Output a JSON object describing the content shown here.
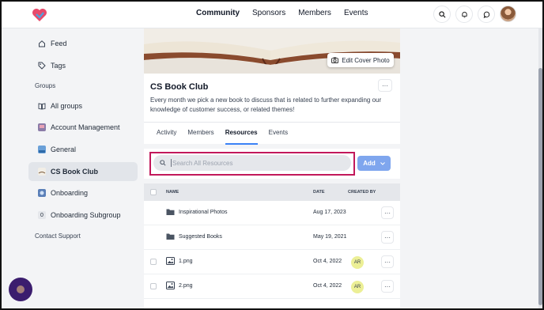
{
  "nav": {
    "links": [
      "Community",
      "Sponsors",
      "Members",
      "Events"
    ],
    "active_index": 0
  },
  "icons": {
    "logo": "heart-logo-icon",
    "search": "search-icon",
    "notifications": "bell-icon",
    "messages": "chat-icon"
  },
  "sidebar": {
    "top_items": [
      {
        "label": "Feed",
        "icon": "home-icon"
      },
      {
        "label": "Tags",
        "icon": "tag-icon"
      }
    ],
    "groups_heading": "Groups",
    "group_items": [
      {
        "label": "All groups",
        "icon": "book-icon"
      },
      {
        "label": "Account Management",
        "icon": "group-avatar-icon"
      },
      {
        "label": "General",
        "icon": "group-avatar-icon"
      },
      {
        "label": "CS Book Club",
        "icon": "group-avatar-icon",
        "active": true
      },
      {
        "label": "Onboarding",
        "icon": "group-avatar-icon"
      },
      {
        "label": "Onboarding Subgroup",
        "icon": "zero-badge-icon",
        "badge": "0"
      }
    ],
    "contact_support": "Contact Support"
  },
  "group": {
    "edit_cover_label": "Edit Cover Photo",
    "title": "CS Book Club",
    "menu": "···",
    "description": "Every month we pick a new book to discuss that is related to further expanding our knowledge of customer success, or related themes!",
    "tabs": [
      "Activity",
      "Members",
      "Resources",
      "Events"
    ],
    "active_tab": 2
  },
  "resources": {
    "search_placeholder": "Search All Resources",
    "add_label": "Add",
    "columns": {
      "name": "NAME",
      "date": "DATE",
      "created_by": "CREATED BY"
    },
    "rows": [
      {
        "name": "Inspirational Photos",
        "date": "Aug 17, 2023",
        "created_by": "",
        "type": "folder"
      },
      {
        "name": "Suggested Books",
        "date": "May 19, 2021",
        "created_by": "",
        "type": "folder"
      },
      {
        "name": "1.png",
        "date": "Oct 4, 2022",
        "created_by": "AR",
        "type": "image"
      },
      {
        "name": "2.png",
        "date": "Oct 4, 2022",
        "created_by": "AR",
        "type": "image"
      }
    ],
    "row_menu": "···"
  },
  "colors": {
    "accent": "#3b82f6",
    "add_button": "#7fa6ee",
    "highlight_box": "#c2185b",
    "badge_bg": "#ecef96",
    "fab": "#3b1d6e"
  }
}
